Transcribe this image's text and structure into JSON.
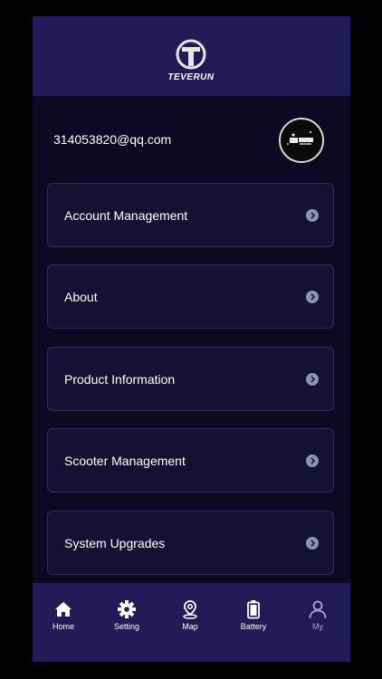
{
  "header": {
    "logo_text": "TEVERUN"
  },
  "profile": {
    "email": "314053820@qq.com"
  },
  "menu": {
    "items": [
      {
        "label": "Account Management"
      },
      {
        "label": "About"
      },
      {
        "label": "Product Information"
      },
      {
        "label": "Scooter Management"
      },
      {
        "label": "System Upgrades"
      }
    ]
  },
  "tabbar": {
    "tabs": [
      {
        "label": "Home",
        "icon": "home-icon"
      },
      {
        "label": "Setting",
        "icon": "gear-icon"
      },
      {
        "label": "Map",
        "icon": "map-pin-icon"
      },
      {
        "label": "Battery",
        "icon": "battery-icon"
      },
      {
        "label": "My",
        "icon": "person-icon"
      }
    ],
    "active": "My"
  },
  "colors": {
    "background": "#0c0a22",
    "header": "#231a58",
    "card": "#141133",
    "active_tab": "#a99fe0"
  }
}
